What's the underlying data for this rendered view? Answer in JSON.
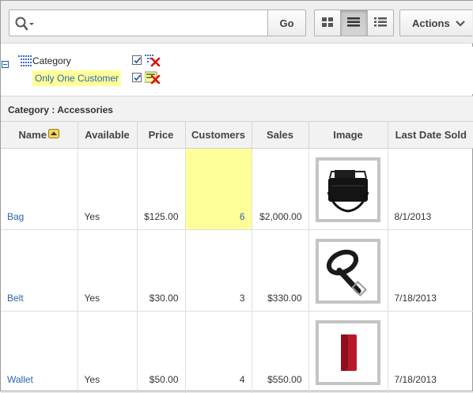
{
  "toolbar": {
    "search": {
      "placeholder": "",
      "value": ""
    },
    "go_label": "Go",
    "view_buttons": [
      {
        "icon": "icon-view-icon",
        "active": false
      },
      {
        "icon": "report-view-icon",
        "active": true
      },
      {
        "icon": "detail-view-icon",
        "active": false
      }
    ],
    "actions_label": "Actions"
  },
  "filters": [
    {
      "label": "Category",
      "checked": true,
      "highlighted": false
    },
    {
      "label": "Only One Customer",
      "checked": true,
      "highlighted": true
    }
  ],
  "report": {
    "group_label": "Category : Accessories",
    "columns": [
      "Name",
      "Available",
      "Price",
      "Customers",
      "Sales",
      "Image",
      "Last Date Sold"
    ],
    "sort_column": "Name",
    "rows": [
      {
        "name": "Bag",
        "available": "Yes",
        "price": "$125.00",
        "customers": "6",
        "sales": "$2,000.00",
        "image": "bag-image",
        "last_date_sold": "8/1/2013",
        "highlight_customers": true
      },
      {
        "name": "Belt",
        "available": "Yes",
        "price": "$30.00",
        "customers": "3",
        "sales": "$330.00",
        "image": "belt-image",
        "last_date_sold": "7/18/2013",
        "highlight_customers": false
      },
      {
        "name": "Wallet",
        "available": "Yes",
        "price": "$50.00",
        "customers": "4",
        "sales": "$550.00",
        "image": "wallet-image",
        "last_date_sold": "7/18/2013",
        "highlight_customers": false
      }
    ]
  },
  "colors": {
    "highlight": "#ffff99",
    "link": "#2b64ad",
    "header_bg": "#f2f2f2",
    "toolbar_bg": "#eeeeee"
  }
}
